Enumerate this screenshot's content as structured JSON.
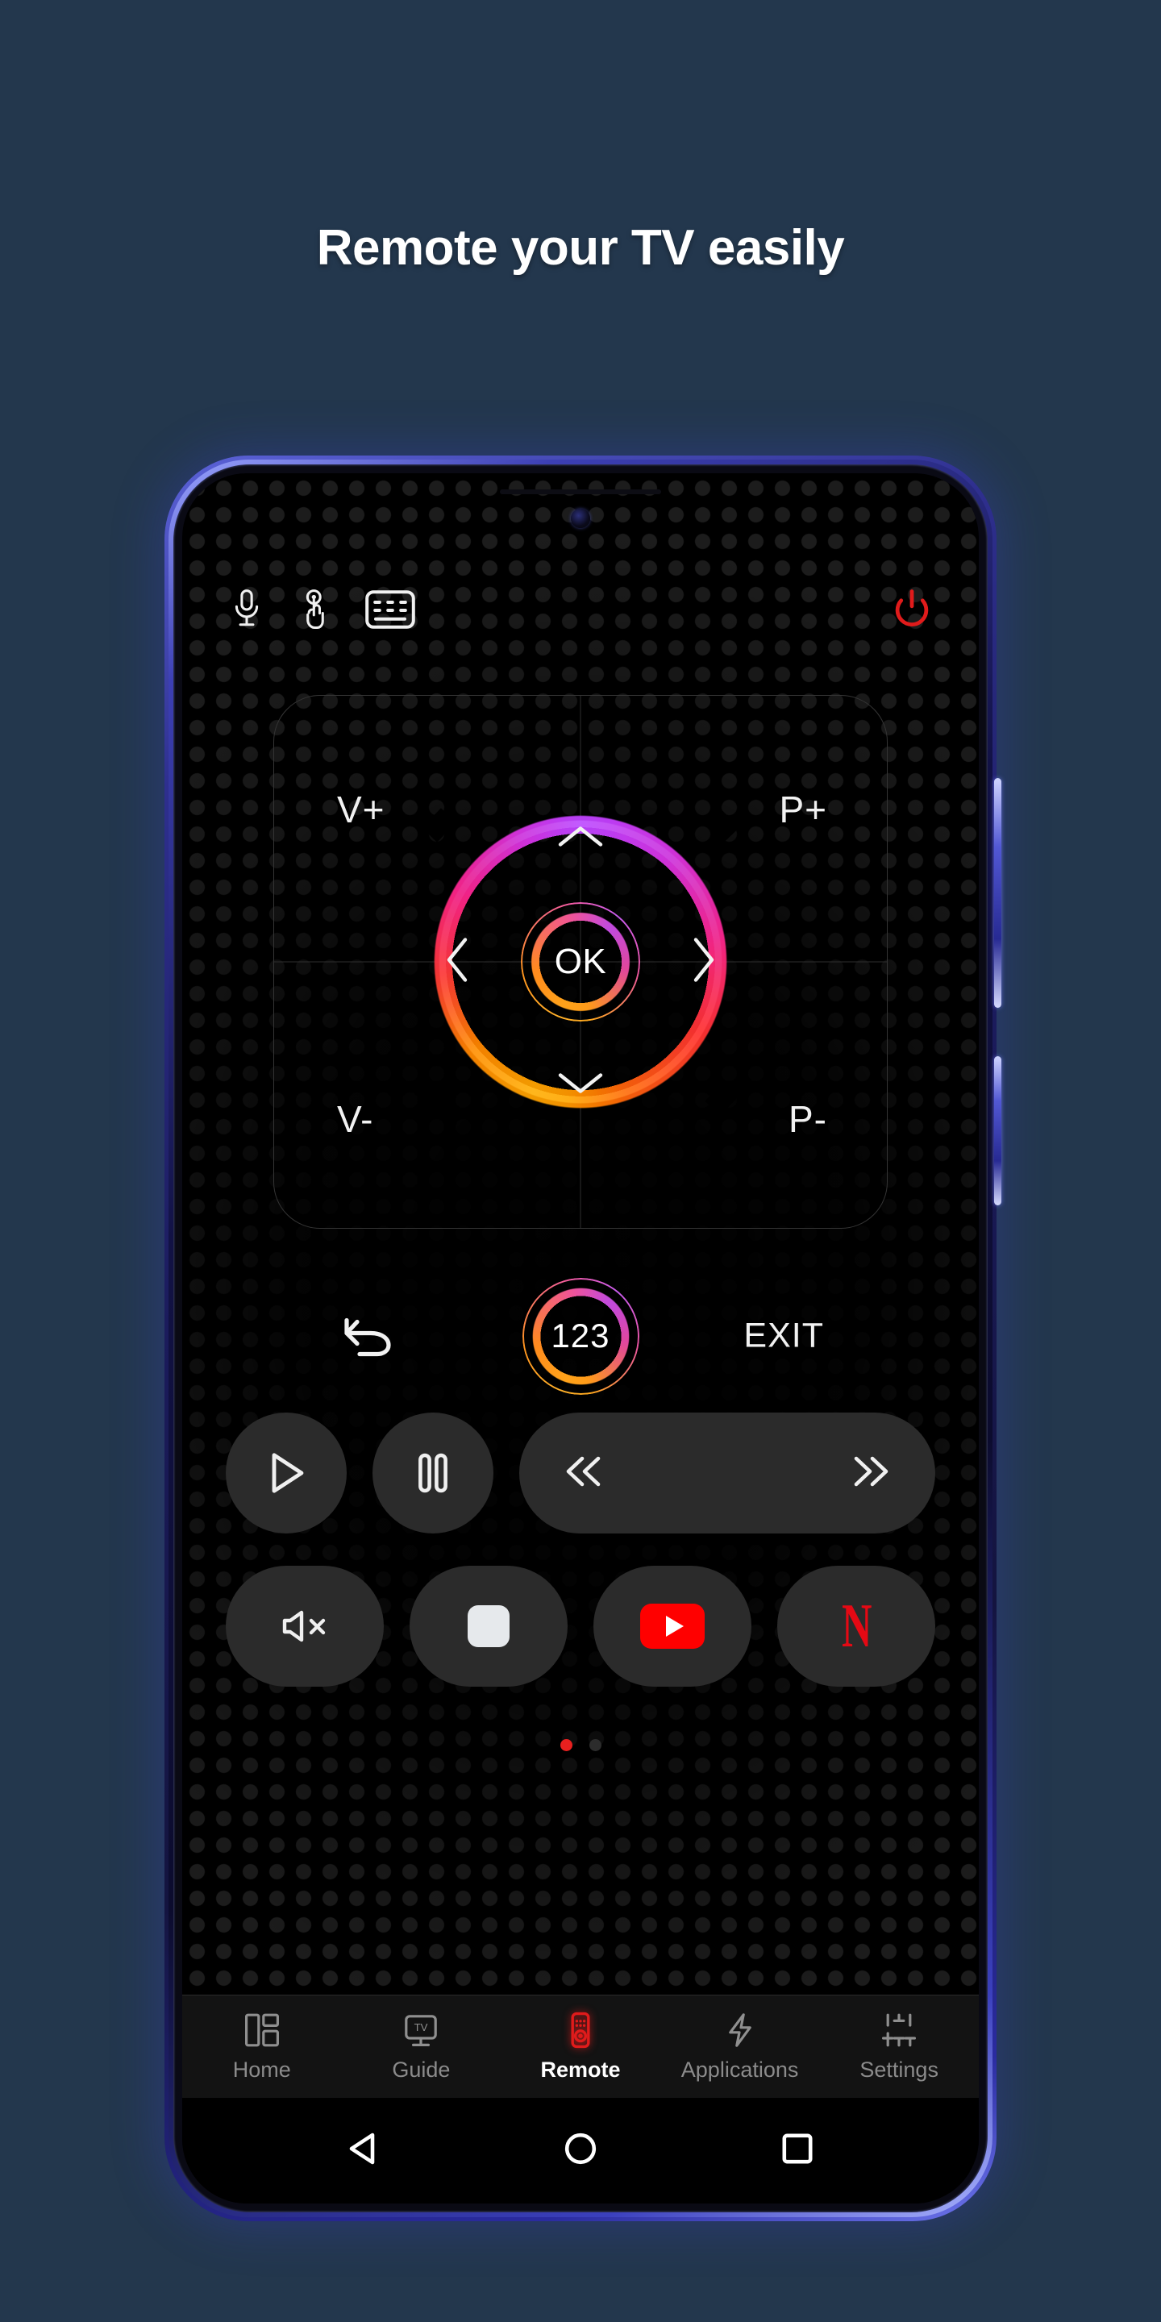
{
  "page": {
    "headline": "Remote your TV easily",
    "background_color": "#23374d"
  },
  "phone": {
    "frame_color": "#3b40bd",
    "screen_color": "#000000"
  },
  "remote": {
    "top_bar": {
      "items": [
        {
          "name": "voice-search",
          "icon": "microphone-icon",
          "color": "#f2f2f2"
        },
        {
          "name": "touchpad",
          "icon": "touch-gesture-icon",
          "color": "#f2f2f2"
        },
        {
          "name": "keyboard",
          "icon": "keyboard-icon",
          "color": "#f2f2f2"
        }
      ],
      "power": {
        "name": "power",
        "icon": "power-icon",
        "color": "#e01b1b"
      }
    },
    "dpad": {
      "labels": {
        "volume_up": "V+",
        "channel_up": "P+",
        "volume_down": "V-",
        "channel_down": "P-"
      },
      "center_label": "OK",
      "arrows": {
        "up": "chevron-up-icon",
        "down": "chevron-down-icon",
        "left": "chevron-left-icon",
        "right": "chevron-right-icon"
      },
      "ring_colors": [
        "#c25bff",
        "#ef3596",
        "#ff4040",
        "#ffb61c"
      ]
    },
    "mid_row": {
      "back": {
        "label": "",
        "icon": "back-arrow-icon"
      },
      "numpad": {
        "label": "123"
      },
      "exit": {
        "label": "EXIT"
      }
    },
    "media_row_1": [
      {
        "name": "play",
        "icon": "play-icon",
        "label": ""
      },
      {
        "name": "pause",
        "icon": "pause-icon",
        "label": ""
      },
      {
        "name": "rewind",
        "icon": "rewind-icon",
        "label": ""
      },
      {
        "name": "fast-forward",
        "icon": "fast-forward-icon",
        "label": ""
      }
    ],
    "media_row_2": [
      {
        "name": "mute",
        "icon": "mute-icon",
        "label": ""
      },
      {
        "name": "stop",
        "icon": "stop-icon",
        "label": ""
      },
      {
        "name": "youtube",
        "icon": "youtube-icon",
        "label": "",
        "color": "#ff0000"
      },
      {
        "name": "netflix",
        "icon": "netflix-icon",
        "label": "N",
        "color": "#e50914"
      }
    ],
    "pager": {
      "total": 2,
      "active_index": 0,
      "active_color": "#e8201f",
      "inactive_color": "#2c2c2c"
    }
  },
  "bottom_nav": {
    "active_index": 2,
    "items": [
      {
        "label": "Home",
        "icon": "layout-panels-icon"
      },
      {
        "label": "Guide",
        "icon": "tv-icon"
      },
      {
        "label": "Remote",
        "icon": "remote-control-icon"
      },
      {
        "label": "Applications",
        "icon": "lightning-bolt-icon"
      },
      {
        "label": "Settings",
        "icon": "sliders-icon"
      }
    ]
  },
  "system_nav": {
    "items": [
      {
        "label": "",
        "icon": "android-back-icon"
      },
      {
        "label": "",
        "icon": "android-home-icon"
      },
      {
        "label": "",
        "icon": "android-recents-icon"
      }
    ]
  }
}
